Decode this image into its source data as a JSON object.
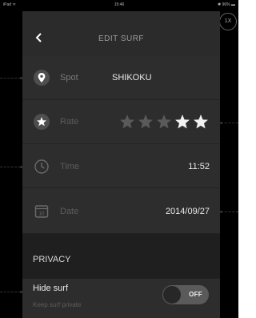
{
  "status_bar": {
    "device": "iPad ᯤ",
    "time": "15:46",
    "battery": "✱ 96% ▬"
  },
  "zoom_badge": "1X",
  "nav": {
    "title": "EDIT SURF",
    "back_icon": "chevron-left-icon"
  },
  "rows": {
    "spot": {
      "label": "Spot",
      "value": "SHIKOKU",
      "icon": "location-pin-icon"
    },
    "rate": {
      "label": "Rate",
      "icon": "star-icon",
      "rating_out_of_5": 2,
      "filled_color": "#f2f2f2",
      "empty_color": "#5a5a5a"
    },
    "time": {
      "label": "Time",
      "value": "11:52",
      "icon": "clock-icon"
    },
    "date": {
      "label": "Date",
      "value": "2014/09/27",
      "icon": "calendar-icon",
      "icon_text": "10"
    }
  },
  "privacy": {
    "section_title": "PRIVACY",
    "hide_surf_label": "Hide surf",
    "hide_surf_sub": "Keep surf private",
    "toggle_text": "OFF"
  }
}
